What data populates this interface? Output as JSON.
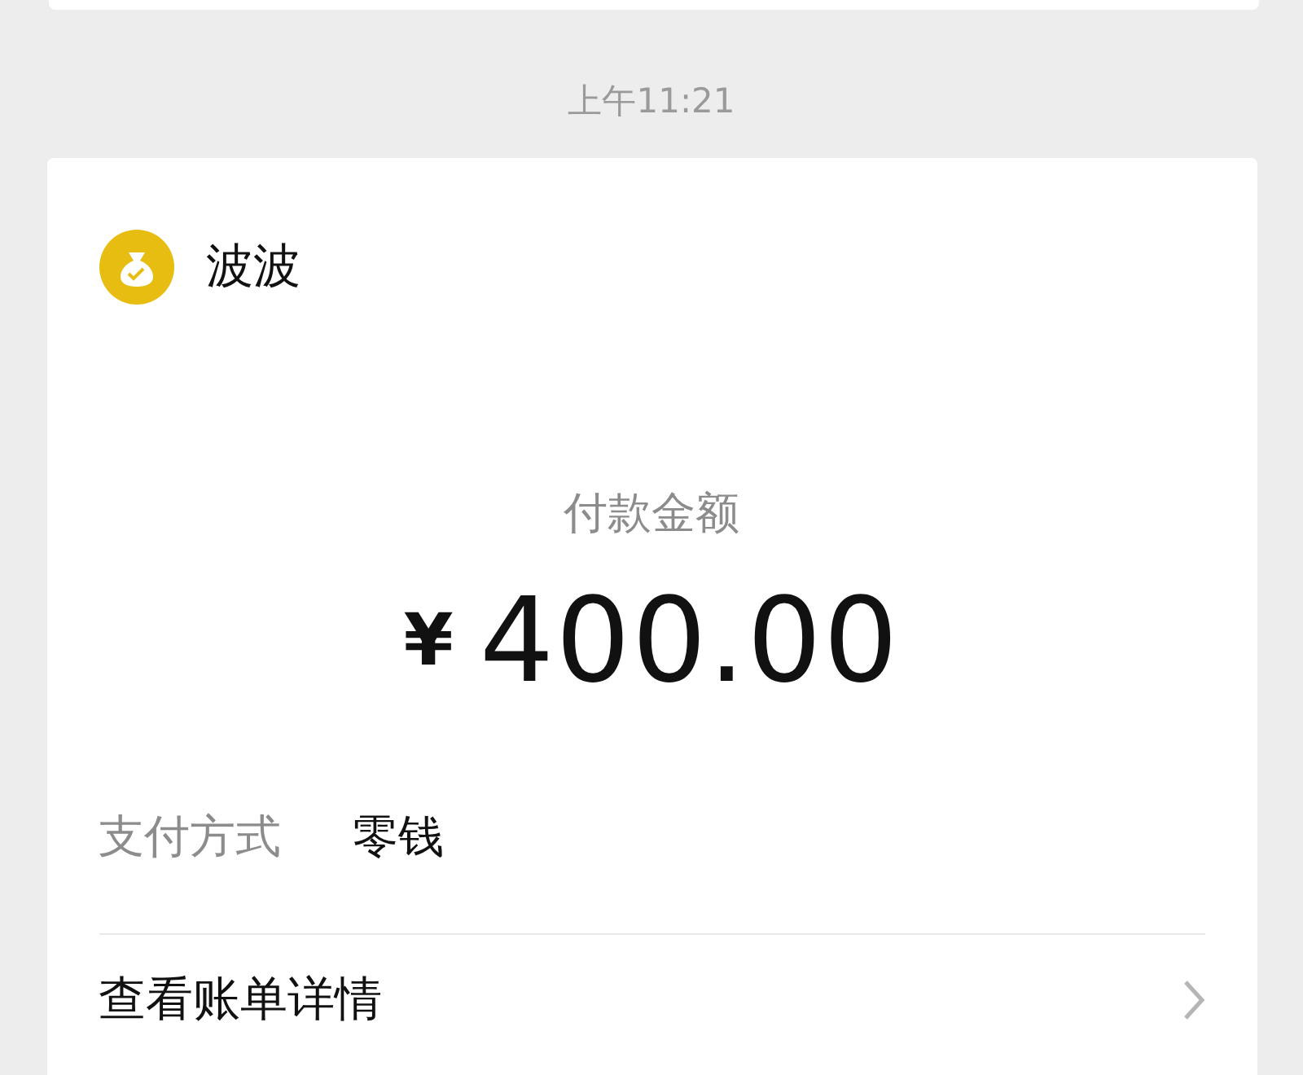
{
  "timestamp": "上午11:21",
  "payment": {
    "payee": "波波",
    "amount_label": "付款金额",
    "amount_symbol": "¥",
    "amount": "400.00",
    "method_label": "支付方式",
    "method_value": "零钱",
    "details_link": "查看账单详情"
  }
}
